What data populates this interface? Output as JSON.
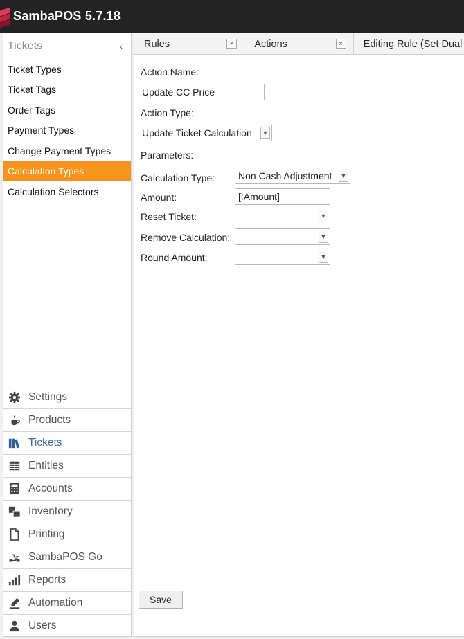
{
  "app": {
    "title": "SambaPOS 5.7.18"
  },
  "sidebar": {
    "header": "Tickets",
    "collapse_glyph": "‹",
    "items": [
      {
        "label": "Ticket Types"
      },
      {
        "label": "Ticket Tags"
      },
      {
        "label": "Order Tags"
      },
      {
        "label": "Payment Types"
      },
      {
        "label": "Change Payment Types"
      },
      {
        "label": "Calculation Types",
        "active": true
      },
      {
        "label": "Calculation Selectors"
      }
    ],
    "nav": [
      {
        "label": "Settings",
        "icon": "gear-icon"
      },
      {
        "label": "Products",
        "icon": "coffee-cup-icon"
      },
      {
        "label": "Tickets",
        "icon": "books-icon",
        "current": true
      },
      {
        "label": "Entities",
        "icon": "table-grid-icon"
      },
      {
        "label": "Accounts",
        "icon": "calculator-icon"
      },
      {
        "label": "Inventory",
        "icon": "boxes-icon"
      },
      {
        "label": "Printing",
        "icon": "document-icon"
      },
      {
        "label": "SambaPOS Go",
        "icon": "scooter-icon"
      },
      {
        "label": "Reports",
        "icon": "bar-chart-icon"
      },
      {
        "label": "Automation",
        "icon": "pencil-icon"
      },
      {
        "label": "Users",
        "icon": "user-icon"
      }
    ]
  },
  "tabs": [
    {
      "label": "Rules",
      "close": "×"
    },
    {
      "label": "Actions",
      "close": "×"
    },
    {
      "label": "Editing Rule (Set Dual"
    }
  ],
  "form": {
    "action_name_label": "Action Name:",
    "action_name_value": "Update CC Price",
    "action_type_label": "Action Type:",
    "action_type_value": "Update Ticket Calculation",
    "parameters_label": "Parameters:",
    "params": [
      {
        "label": "Calculation Type:",
        "value": "Non Cash Adjustment",
        "combo": true
      },
      {
        "label": "Amount:",
        "value": "[:Amount]",
        "combo": false
      },
      {
        "label": "Reset Ticket:",
        "value": "",
        "combo": true
      },
      {
        "label": "Remove Calculation:",
        "value": "",
        "combo": true
      },
      {
        "label": "Round Amount:",
        "value": "",
        "combo": true
      }
    ],
    "save_label": "Save"
  },
  "colors": {
    "accent": "#f7941d",
    "titlebar": "#232323",
    "current_nav": "#3a6ea5"
  }
}
